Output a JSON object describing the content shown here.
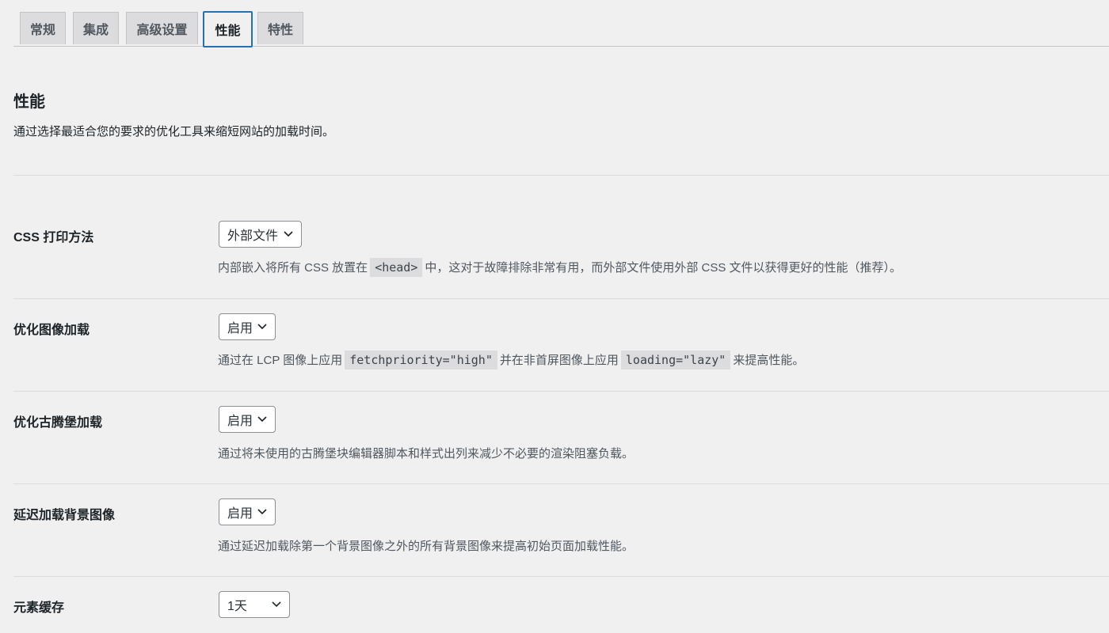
{
  "tabs": [
    {
      "label": "常规",
      "active": false
    },
    {
      "label": "集成",
      "active": false
    },
    {
      "label": "高级设置",
      "active": false
    },
    {
      "label": "性能",
      "active": true
    },
    {
      "label": "特性",
      "active": false
    }
  ],
  "section": {
    "title": "性能",
    "description": "通过选择最适合您的要求的优化工具来缩短网站的加载时间。"
  },
  "settings": [
    {
      "label": "CSS 打印方法",
      "value": "外部文件",
      "help": {
        "pre": "内部嵌入将所有 CSS 放置在",
        "code1": "<head>",
        "mid": "中，这对于故障排除非常有用，而外部文件使用外部 CSS 文件以获得更好的性能（推荐）。"
      }
    },
    {
      "label": "优化图像加载",
      "value": "启用",
      "help": {
        "pre": "通过在 LCP 图像上应用",
        "code1": "fetchpriority=\"high\"",
        "mid": "并在非首屏图像上应用",
        "code2": "loading=\"lazy\"",
        "post": "来提高性能。"
      }
    },
    {
      "label": "优化古腾堡加载",
      "value": "启用",
      "help": {
        "text": "通过将未使用的古腾堡块编辑器脚本和样式出列来减少不必要的渲染阻塞负载。"
      }
    },
    {
      "label": "延迟加载背景图像",
      "value": "启用",
      "help": {
        "text": "通过延迟加载除第一个背景图像之外的所有背景图像来提高初始页面加载性能。"
      }
    },
    {
      "label": "元素缓存",
      "value": "1天",
      "help": {
        "text": ""
      }
    }
  ],
  "colors": {
    "background": "#f0f0f1",
    "active_tab_border": "#2271b1",
    "inactive_tab_bg": "#dcdcde",
    "code_bg": "#dcdcde"
  },
  "icons": {
    "select_arrow": "chevron-down-icon"
  }
}
